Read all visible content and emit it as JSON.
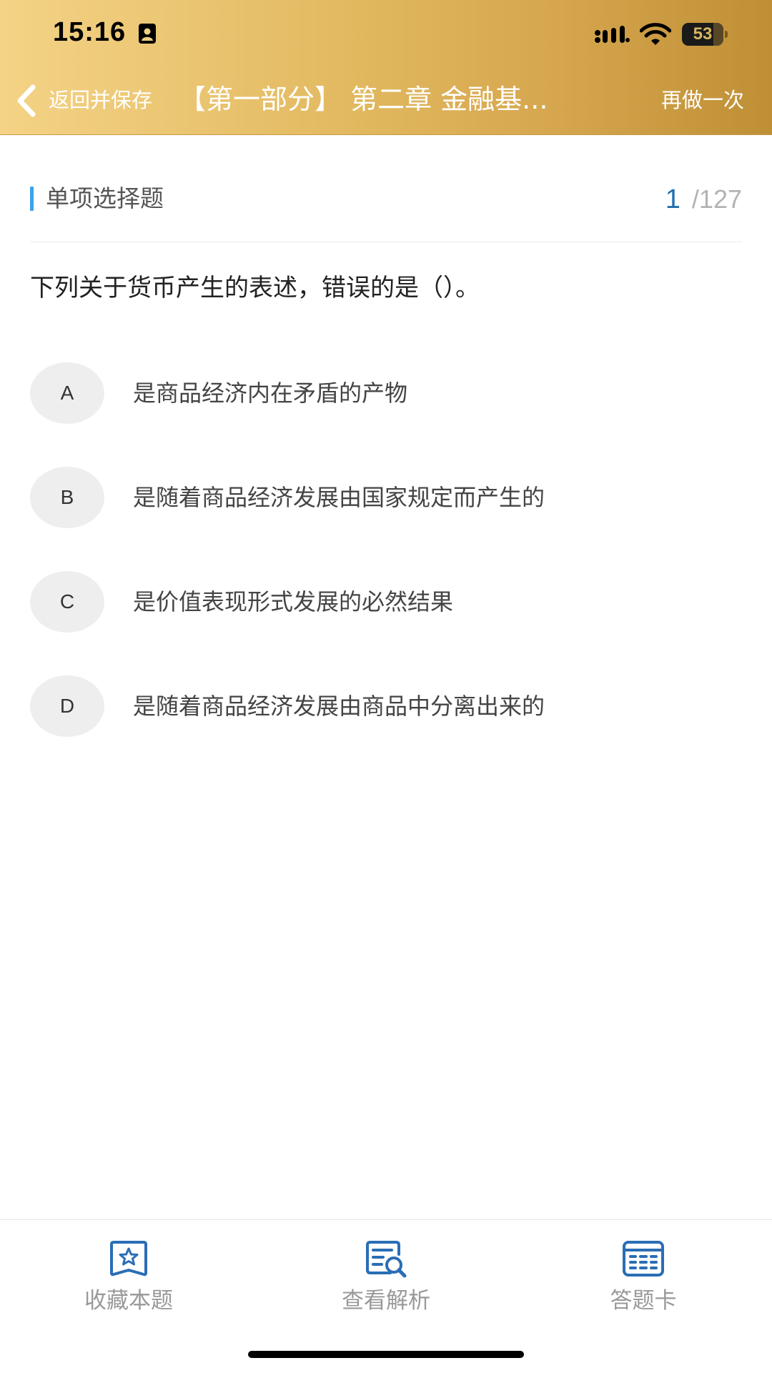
{
  "status_bar": {
    "time": "15:16",
    "battery": "53"
  },
  "nav": {
    "back_label": "返回并保存",
    "title": "【第一部分】 第二章  金融基...",
    "redo_label": "再做一次"
  },
  "question": {
    "type_label": "单项选择题",
    "current": "1",
    "total": "/127",
    "text": "下列关于货币产生的表述，错误的是（）。",
    "options": [
      {
        "letter": "A",
        "text": "是商品经济内在矛盾的产物"
      },
      {
        "letter": "B",
        "text": "是随着商品经济发展由国家规定而产生的"
      },
      {
        "letter": "C",
        "text": "是价值表现形式发展的必然结果"
      },
      {
        "letter": "D",
        "text": "是随着商品经济发展由商品中分离出来的"
      }
    ]
  },
  "toolbar": {
    "favorite_label": "收藏本题",
    "analysis_label": "查看解析",
    "answer_card_label": "答题卡"
  },
  "colors": {
    "header_gradient_start": "#f4d386",
    "header_gradient_end": "#bf8f36",
    "accent_blue": "#3aa3ea",
    "progress_current": "#1f6fb0",
    "icon_blue": "#2a6db5",
    "option_circle_bg": "#eeeeee"
  },
  "icons": {
    "back": "chevron-left-icon",
    "favorite": "star-bookmark-icon",
    "analysis": "document-search-icon",
    "answer_card": "grid-card-icon"
  }
}
